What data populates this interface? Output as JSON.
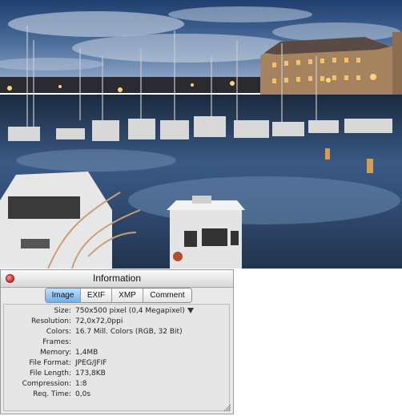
{
  "window": {
    "title": "Information"
  },
  "tabs": [
    {
      "label": "Image",
      "active": true
    },
    {
      "label": "EXIF",
      "active": false
    },
    {
      "label": "XMP",
      "active": false
    },
    {
      "label": "Comment",
      "active": false
    }
  ],
  "info": {
    "size": {
      "label": "Size:",
      "value": "750x500 pixel (0,4 Megapixel)"
    },
    "resolution": {
      "label": "Resolution:",
      "value": "72,0x72,0ppi"
    },
    "colors": {
      "label": "Colors:",
      "value": "16.7 Mill. Colors (RGB, 32 Bit)"
    },
    "frames": {
      "label": "Frames:",
      "value": ""
    },
    "memory": {
      "label": "Memory:",
      "value": "1,4MB"
    },
    "file_format": {
      "label": "File Format:",
      "value": "JPEG/JFIF"
    },
    "file_length": {
      "label": "File Length:",
      "value": "173,8KB"
    },
    "compression": {
      "label": "Compression:",
      "value": "1:8"
    },
    "req_time": {
      "label": "Req. Time:",
      "value": "0,0s"
    }
  },
  "icons": [
    "close-icon",
    "dropdown-arrow-icon",
    "resize-grip-icon"
  ],
  "colors": {
    "tab_active": "#6fb0ee",
    "close_button": "#d33a25",
    "panel_bg": "#e9e9e9"
  }
}
